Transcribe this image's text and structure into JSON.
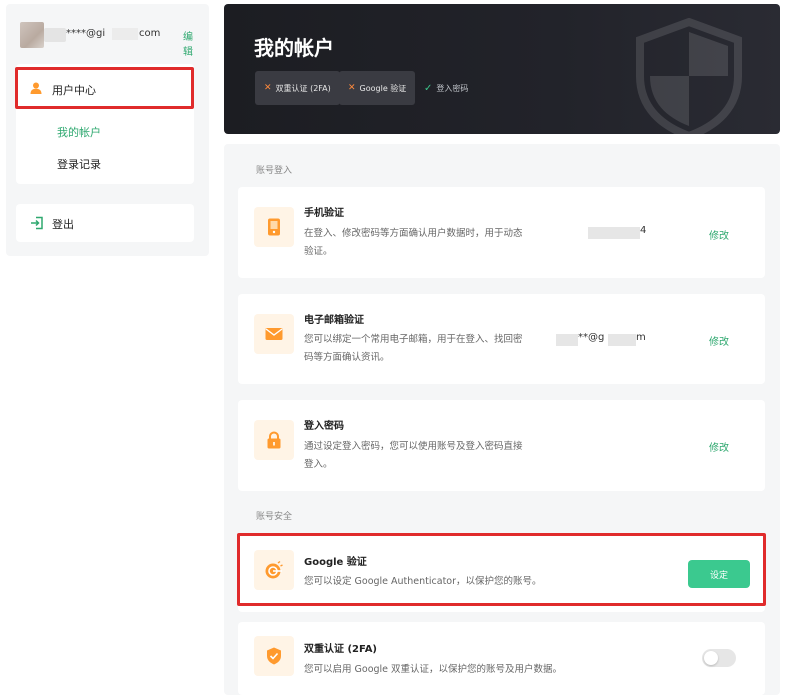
{
  "sidebar": {
    "user_email": "****@gi",
    "user_email_tail": "com",
    "edit_label": "编辑",
    "menu_label": "用户中心",
    "sub_items": [
      {
        "label": "我的帐户"
      },
      {
        "label": "登录记录"
      }
    ],
    "logout_label": "登出"
  },
  "banner": {
    "title": "我的帐户",
    "tags": [
      {
        "label": "双重认证 (2FA)",
        "status": "x"
      },
      {
        "label": "Google 验证",
        "status": "x"
      }
    ],
    "ok_tag": {
      "label": "登入密码"
    }
  },
  "sections": {
    "login": "账号登入",
    "security": "账号安全"
  },
  "cards": {
    "phone": {
      "title": "手机验证",
      "desc": "在登入、修改密码等方面确认用户数据时，用于动态验证。",
      "value": "4",
      "action": "修改"
    },
    "email": {
      "title": "电子邮箱验证",
      "desc": "您可以绑定一个常用电子邮箱，用于在登入、找回密码等方面确认资讯。",
      "value": "**@g",
      "value_tail": "m",
      "action": "修改"
    },
    "password": {
      "title": "登入密码",
      "desc": "通过设定登入密码，您可以使用账号及登入密码直接登入。",
      "action": "修改"
    },
    "google": {
      "title": "Google 验证",
      "desc": "您可以设定 Google Authenticator，以保护您的账号。",
      "action": "设定"
    },
    "twofa": {
      "title": "双重认证 (2FA)",
      "desc": "您可以启用 Google 双重认证，以保护您的账号及用户数据。",
      "enabled": false
    }
  },
  "colors": {
    "accent": "#2ea86f",
    "button": "#3bc98f",
    "highlight": "#e02b2b",
    "icon_orange": "#ff9a2e"
  }
}
